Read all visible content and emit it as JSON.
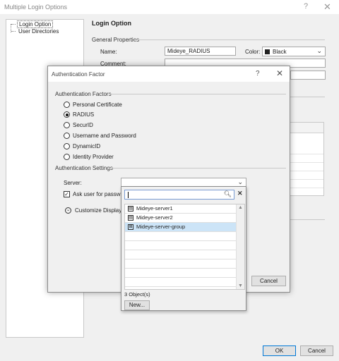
{
  "outer_window": {
    "title": "Multiple Login Options",
    "help": "?",
    "close": "✕"
  },
  "tree": {
    "items": [
      {
        "label": "Login Option"
      },
      {
        "label": "User Directories"
      }
    ]
  },
  "main": {
    "heading": "Login Option",
    "general_properties": "General Properties",
    "name_label": "Name:",
    "name_value": "Mideye_RADIUS",
    "color_label": "Color:",
    "color_value": "Black",
    "comment_label": "Comment:"
  },
  "footer": {
    "ok": "OK",
    "cancel": "Cancel"
  },
  "dialog": {
    "title": "Authentication Factor",
    "help": "?",
    "close": "✕",
    "factors_label": "Authentication Factors",
    "options": [
      {
        "label": "Personal Certificate",
        "selected": false
      },
      {
        "label": "RADIUS",
        "selected": true
      },
      {
        "label": "SecurID",
        "selected": false
      },
      {
        "label": "Username and Password",
        "selected": false
      },
      {
        "label": "DynamicID",
        "selected": false
      },
      {
        "label": "Identity Provider",
        "selected": false
      }
    ],
    "settings_label": "Authentication Settings",
    "server_label": "Server:",
    "ask_user_label": "Ask user for password",
    "ask_user_checked": true,
    "customize_label": "Customize Display",
    "cancel": "Cancel"
  },
  "server_dropdown": {
    "search_value": "",
    "items": [
      {
        "label": "Mideye-server1",
        "icon": "server-icon",
        "selected": false
      },
      {
        "label": "Mideye-server2",
        "icon": "server-icon",
        "selected": false
      },
      {
        "label": "Mideye-server-group",
        "icon": "server-group-icon",
        "selected": true
      }
    ],
    "count": "3 Object(s)",
    "new_button": "New..."
  },
  "colors": {
    "selection": "#cce4f7",
    "accent_border": "#0078d7"
  }
}
